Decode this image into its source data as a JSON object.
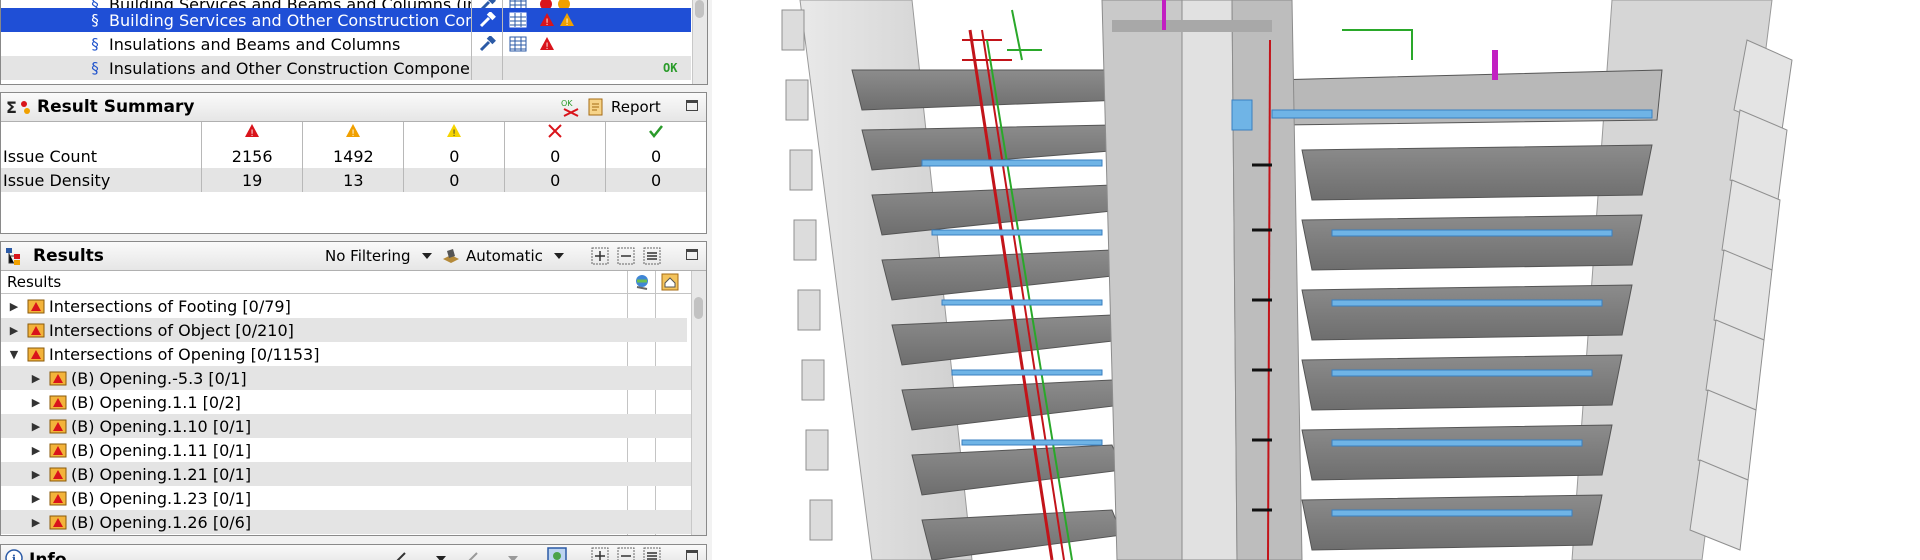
{
  "rules_list": {
    "rows": [
      {
        "name": "Building Services and Beams and Columns (ins",
        "selected": false
      },
      {
        "name": "Building Services and Other Construction Comp",
        "selected": true
      },
      {
        "name": "Insulations and Beams and Columns",
        "selected": false
      },
      {
        "name": "Insulations and Other Construction Component",
        "selected": false,
        "status": "OK"
      }
    ]
  },
  "result_summary": {
    "title": "Result Summary",
    "report_label": "Report",
    "rows": [
      {
        "label": "Issue Count",
        "values": [
          "2156",
          "1492",
          "0",
          "0",
          "0"
        ]
      },
      {
        "label": "Issue Density",
        "values": [
          "19",
          "13",
          "0",
          "0",
          "0"
        ]
      }
    ]
  },
  "results": {
    "title": "Results",
    "filter_label": "No Filtering",
    "mode_label": "Automatic",
    "column_header": "Results",
    "items": [
      {
        "label": "Intersections of Footing [0/79]",
        "level": 0,
        "expanded": false
      },
      {
        "label": "Intersections of Object [0/210]",
        "level": 0,
        "expanded": false
      },
      {
        "label": "Intersections of Opening [0/1153]",
        "level": 0,
        "expanded": true
      },
      {
        "label": "(B) Opening.-5.3 [0/1]",
        "level": 1,
        "expanded": false
      },
      {
        "label": "(B) Opening.1.1 [0/2]",
        "level": 1,
        "expanded": false
      },
      {
        "label": "(B) Opening.1.10 [0/1]",
        "level": 1,
        "expanded": false
      },
      {
        "label": "(B) Opening.1.11 [0/1]",
        "level": 1,
        "expanded": false
      },
      {
        "label": "(B) Opening.1.21 [0/1]",
        "level": 1,
        "expanded": false
      },
      {
        "label": "(B) Opening.1.23 [0/1]",
        "level": 1,
        "expanded": false
      },
      {
        "label": "(B) Opening.1.26 [0/6]",
        "level": 1,
        "expanded": false
      }
    ]
  },
  "info_panel": {
    "title": "Info"
  },
  "colors": {
    "selection": "#1f4fd6",
    "critical": "#d9141b",
    "moderate": "#f0a000",
    "low": "#f5d400",
    "ok": "#2a9b2a"
  }
}
